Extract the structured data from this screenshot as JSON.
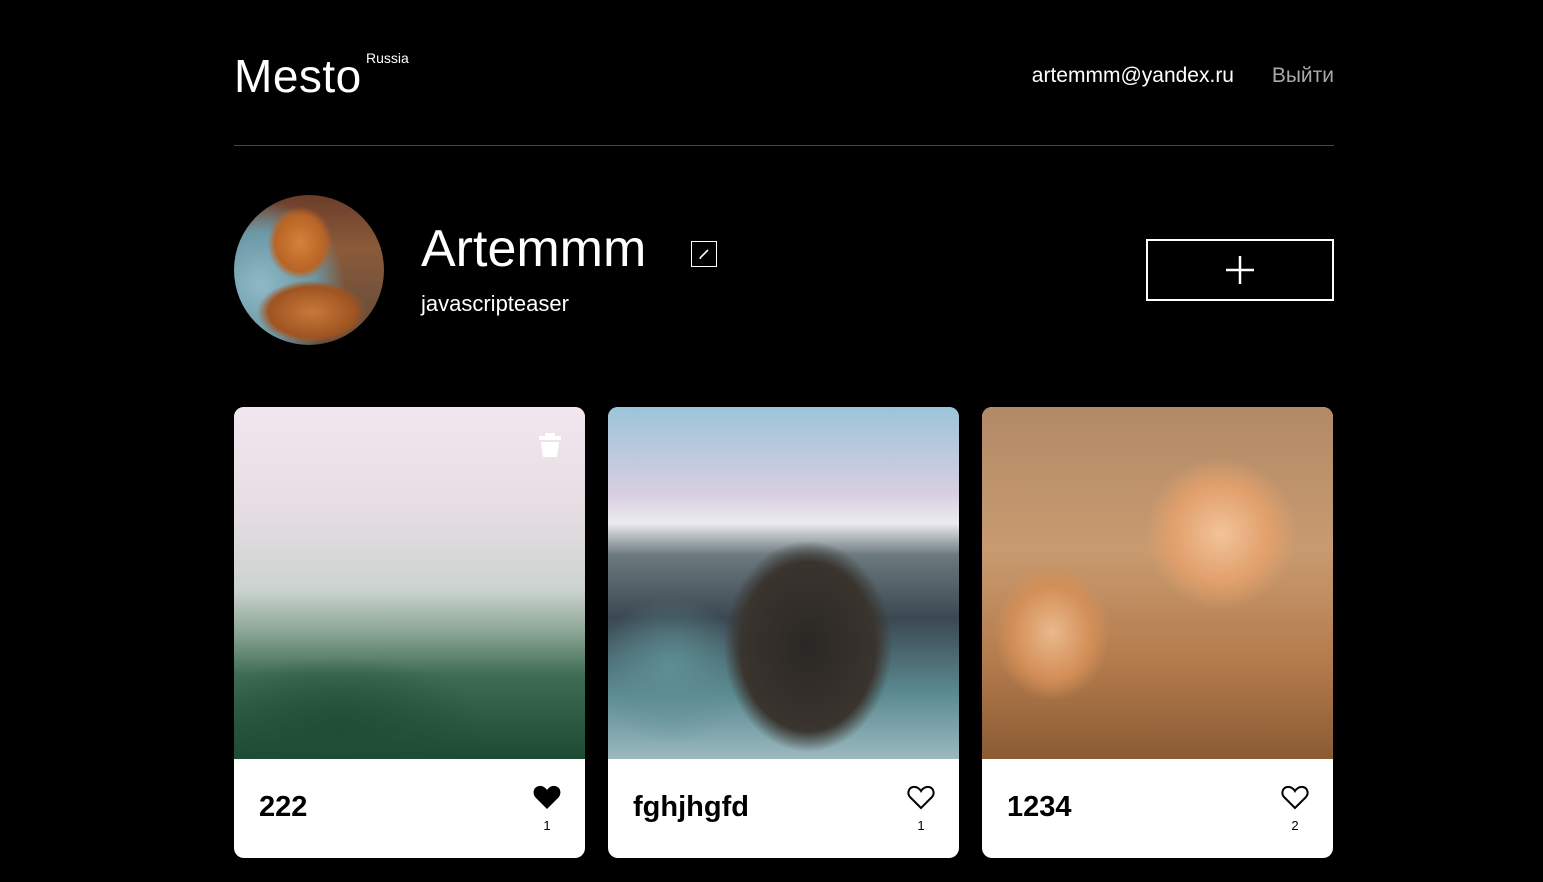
{
  "header": {
    "logo": "Mesto",
    "logo_sub": "Russia",
    "email": "artemmm@yandex.ru",
    "logout": "Выйти"
  },
  "profile": {
    "name": "Artemmm",
    "about": "javascripteaser"
  },
  "cards": [
    {
      "title": "222",
      "likes": "1",
      "liked": true,
      "deletable": true
    },
    {
      "title": "fghjhgfd",
      "likes": "1",
      "liked": false,
      "deletable": false
    },
    {
      "title": "1234",
      "likes": "2",
      "liked": false,
      "deletable": false
    }
  ],
  "colors": {
    "background": "#000000",
    "card": "#ffffff",
    "logout": "#a9a9a9"
  },
  "icons": [
    "pencil-icon",
    "plus-icon",
    "heart-icon",
    "trash-icon"
  ]
}
